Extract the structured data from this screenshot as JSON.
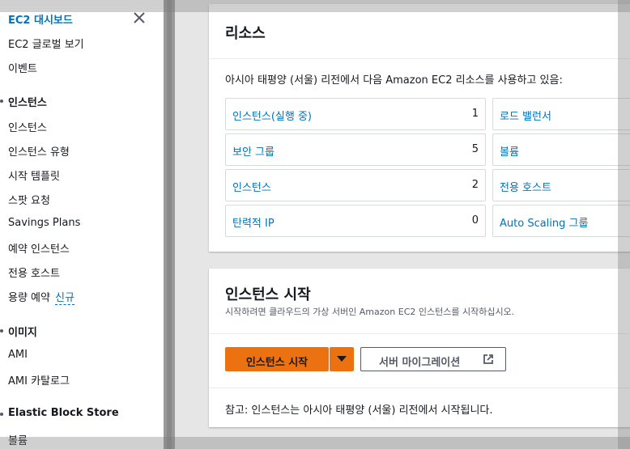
{
  "sidebar": {
    "items": [
      {
        "label": "EC2 대시보드",
        "active": true
      },
      {
        "label": "EC2 글로벌 보기"
      },
      {
        "label": "이벤트"
      }
    ],
    "sections": [
      {
        "heading": "인스턴스",
        "items": [
          "인스턴스",
          "인스턴스 유형",
          "시작 템플릿",
          "스팟 요청",
          "Savings Plans",
          "예약 인스턴스",
          "전용 호스트",
          "용량 예약"
        ]
      },
      {
        "heading": "이미지",
        "items": [
          "AMI",
          "AMI 카탈로그"
        ]
      },
      {
        "heading": "Elastic Block Store",
        "items": [
          "볼륨"
        ]
      }
    ],
    "new_badge": "신규"
  },
  "resources": {
    "title": "리소스",
    "description": "아시아 태평양 (서울) 리전에서 다음 Amazon EC2 리소스를 사용하고 있음:",
    "left": [
      {
        "label": "인스턴스(실행 중)",
        "count": "1"
      },
      {
        "label": "보안 그룹",
        "count": "5"
      },
      {
        "label": "인스턴스",
        "count": "2"
      },
      {
        "label": "탄력적 IP",
        "count": "0"
      }
    ],
    "right": [
      {
        "label": "로드 밸런서"
      },
      {
        "label": "볼륨"
      },
      {
        "label": "전용 호스트"
      },
      {
        "label": "Auto Scaling 그룹"
      }
    ]
  },
  "launch": {
    "title": "인스턴스 시작",
    "subtitle": "시작하려면 클라우드의 가상 서버인 Amazon EC2 인스턴스를 시작하십시오.",
    "primary_button": "인스턴스 시작",
    "secondary_button": "서버 마이그레이션",
    "note": "참고: 인스턴스는 아시아 태평양 (서울) 리전에서 시작됩니다."
  },
  "colors": {
    "accent": "#ec7211",
    "link": "#0073bb"
  }
}
